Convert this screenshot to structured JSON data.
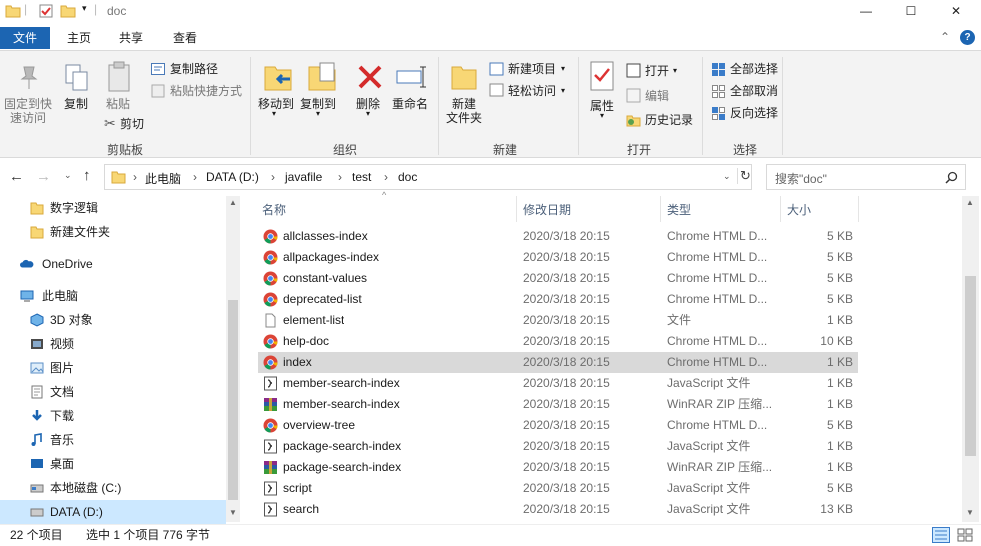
{
  "window": {
    "title": "doc",
    "minimize": "—",
    "maximize": "☐",
    "close": "✕"
  },
  "tabs": [
    "文件",
    "主页",
    "共享",
    "查看"
  ],
  "ribbon": {
    "clipboard": {
      "pin": "固定到快",
      "pin2": "速访问",
      "copy": "复制",
      "paste": "粘贴",
      "copy_path": "复制路径",
      "paste_shortcut": "粘贴快捷方式",
      "cut": "剪切",
      "group": "剪贴板"
    },
    "organize": {
      "move_to": "移动到",
      "copy_to": "复制到",
      "delete": "删除",
      "rename": "重命名",
      "group": "组织"
    },
    "new": {
      "new_item": "新建项目",
      "easy_access": "轻松访问",
      "new_folder": "新建",
      "new_folder2": "文件夹",
      "group": "新建"
    },
    "open": {
      "properties": "属性",
      "open": "打开",
      "edit": "编辑",
      "history": "历史记录",
      "group": "打开"
    },
    "select": {
      "select_all": "全部选择",
      "select_none": "全部取消",
      "invert": "反向选择",
      "group": "选择"
    }
  },
  "breadcrumb": [
    "此电脑",
    "DATA (D:)",
    "javafile",
    "test",
    "doc"
  ],
  "search": {
    "placeholder": "搜索\"doc\""
  },
  "nav": [
    {
      "label": "数字逻辑",
      "icon": "folder-icon"
    },
    {
      "label": "新建文件夹",
      "icon": "folder-icon"
    },
    {
      "label": "OneDrive",
      "icon": "cloud-icon"
    },
    {
      "label": "此电脑",
      "icon": "computer-icon"
    },
    {
      "label": "3D 对象",
      "icon": "cube-icon"
    },
    {
      "label": "视频",
      "icon": "video-icon"
    },
    {
      "label": "图片",
      "icon": "picture-icon"
    },
    {
      "label": "文档",
      "icon": "document-icon"
    },
    {
      "label": "下载",
      "icon": "download-icon"
    },
    {
      "label": "音乐",
      "icon": "music-icon"
    },
    {
      "label": "桌面",
      "icon": "desktop-icon"
    },
    {
      "label": "本地磁盘 (C:)",
      "icon": "drive-icon"
    },
    {
      "label": "DATA (D:)",
      "icon": "drive-icon"
    }
  ],
  "columns": {
    "name": "名称",
    "date": "修改日期",
    "type": "类型",
    "size": "大小"
  },
  "files": [
    {
      "name": "allclasses-index",
      "date": "2020/3/18 20:15",
      "type": "Chrome HTML D...",
      "size": "5 KB",
      "icon": "chrome"
    },
    {
      "name": "allpackages-index",
      "date": "2020/3/18 20:15",
      "type": "Chrome HTML D...",
      "size": "5 KB",
      "icon": "chrome"
    },
    {
      "name": "constant-values",
      "date": "2020/3/18 20:15",
      "type": "Chrome HTML D...",
      "size": "5 KB",
      "icon": "chrome"
    },
    {
      "name": "deprecated-list",
      "date": "2020/3/18 20:15",
      "type": "Chrome HTML D...",
      "size": "5 KB",
      "icon": "chrome"
    },
    {
      "name": "element-list",
      "date": "2020/3/18 20:15",
      "type": "文件",
      "size": "1 KB",
      "icon": "file"
    },
    {
      "name": "help-doc",
      "date": "2020/3/18 20:15",
      "type": "Chrome HTML D...",
      "size": "10 KB",
      "icon": "chrome"
    },
    {
      "name": "index",
      "date": "2020/3/18 20:15",
      "type": "Chrome HTML D...",
      "size": "1 KB",
      "icon": "chrome",
      "selected": true
    },
    {
      "name": "member-search-index",
      "date": "2020/3/18 20:15",
      "type": "JavaScript 文件",
      "size": "1 KB",
      "icon": "js"
    },
    {
      "name": "member-search-index",
      "date": "2020/3/18 20:15",
      "type": "WinRAR ZIP 压缩...",
      "size": "1 KB",
      "icon": "zip"
    },
    {
      "name": "overview-tree",
      "date": "2020/3/18 20:15",
      "type": "Chrome HTML D...",
      "size": "5 KB",
      "icon": "chrome"
    },
    {
      "name": "package-search-index",
      "date": "2020/3/18 20:15",
      "type": "JavaScript 文件",
      "size": "1 KB",
      "icon": "js"
    },
    {
      "name": "package-search-index",
      "date": "2020/3/18 20:15",
      "type": "WinRAR ZIP 压缩...",
      "size": "1 KB",
      "icon": "zip"
    },
    {
      "name": "script",
      "date": "2020/3/18 20:15",
      "type": "JavaScript 文件",
      "size": "5 KB",
      "icon": "js"
    },
    {
      "name": "search",
      "date": "2020/3/18 20:15",
      "type": "JavaScript 文件",
      "size": "13 KB",
      "icon": "js"
    }
  ],
  "status": {
    "count": "22 个项目",
    "selected": "选中 1 个项目  776 字节"
  },
  "colors": {
    "accent": "#1c65b2",
    "selected_row": "#d9d9d9",
    "folder": "#f8d775"
  }
}
